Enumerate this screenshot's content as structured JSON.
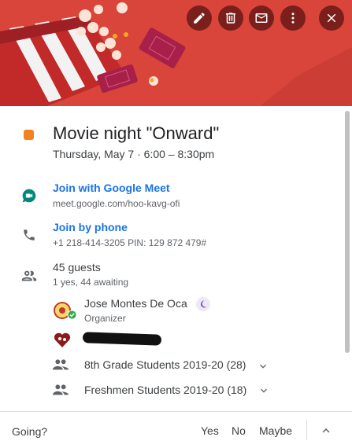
{
  "header": {
    "colors": {
      "background": "#d9443b",
      "button": "#7a1f1c"
    },
    "actions": [
      {
        "icon": "pencil-icon",
        "name": "edit-event-button"
      },
      {
        "icon": "trash-icon",
        "name": "delete-event-button"
      },
      {
        "icon": "envelope-icon",
        "name": "email-guests-button"
      },
      {
        "icon": "more-vert-icon",
        "name": "more-options-button"
      },
      {
        "icon": "close-icon",
        "name": "close-button"
      }
    ]
  },
  "event": {
    "color": "#f4811f",
    "title": "Movie night \"Onward\"",
    "date_time": "Thursday, May 7  ·  6:00 – 8:30pm"
  },
  "meet": {
    "icon": "google-meet-icon",
    "label": "Join with Google Meet",
    "url": "meet.google.com/hoo-kavg-ofi"
  },
  "phone": {
    "icon": "phone-icon",
    "label": "Join by phone",
    "details": "+1 218-414-3205 PIN: 129 872 479#"
  },
  "guests": {
    "icon": "people-icon",
    "count": "45 guests",
    "summary": "1 yes, 44 awaiting",
    "list": [
      {
        "name": "Jose Montes De Oca",
        "role": "Organizer",
        "status_icon": "check-icon",
        "badge_icon": "moon-icon"
      },
      {
        "name": "",
        "role": "",
        "redacted": true
      },
      {
        "name": "8th Grade Students 2019-20 (28)",
        "icon": "group-icon",
        "expand_icon": "chevron-down-icon"
      },
      {
        "name": "Freshmen Students 2019-20 (18)",
        "icon": "group-icon",
        "expand_icon": "chevron-down-icon"
      }
    ]
  },
  "footer": {
    "prompt": "Going?",
    "yes": "Yes",
    "no": "No",
    "maybe": "Maybe",
    "collapse_icon": "chevron-up-icon"
  }
}
